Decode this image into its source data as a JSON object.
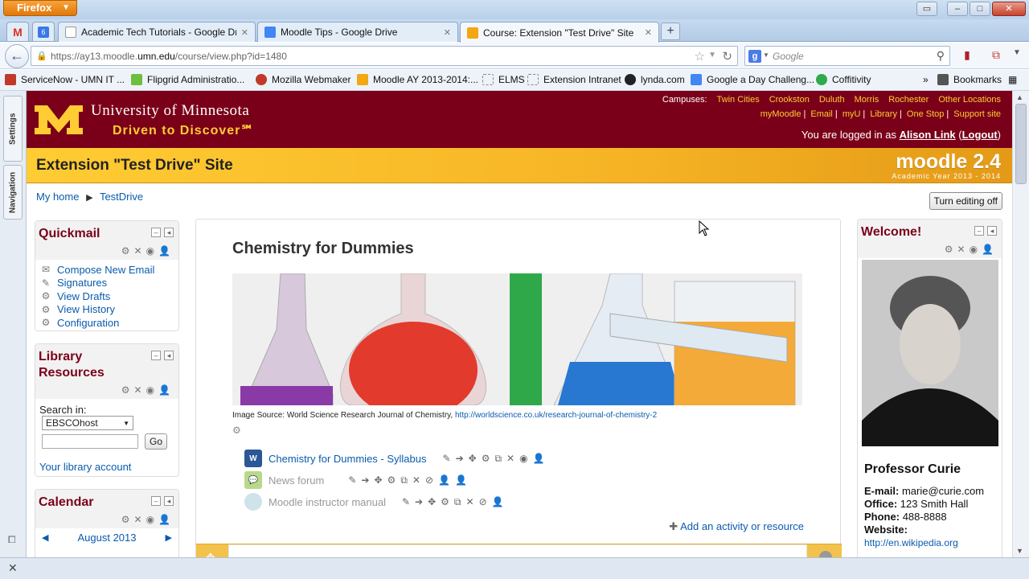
{
  "browser": {
    "menu_label": "Firefox",
    "tabs": [
      {
        "title": "Academic Tech Tutorials - Google Dri..."
      },
      {
        "title": "Moodle Tips - Google Drive"
      },
      {
        "title": "Course: Extension \"Test Drive\" Site"
      }
    ],
    "url_prefix": "https://ay13.moodle.",
    "url_host": "umn.edu",
    "url_path": "/course/view.php?id=1480",
    "search_placeholder": "Google",
    "bookmarks": [
      {
        "label": "ServiceNow - UMN IT ..."
      },
      {
        "label": "Flipgrid Administratio..."
      },
      {
        "label": "Mozilla Webmaker"
      },
      {
        "label": "Moodle AY 2013-2014:..."
      },
      {
        "label": "ELMS"
      },
      {
        "label": "Extension Intranet"
      },
      {
        "label": "lynda.com"
      },
      {
        "label": "Google a Day Challeng..."
      },
      {
        "label": "Coffitivity"
      }
    ],
    "bookmarks_menu": "Bookmarks",
    "overflow": "»"
  },
  "sidebar": {
    "settings": "Settings",
    "navigation": "Navigation"
  },
  "header": {
    "university": "University of Minnesota",
    "tagline": "Driven to Discover℠",
    "campuses_label": "Campuses:",
    "campuses": [
      "Twin Cities",
      "Crookston",
      "Duluth",
      "Morris",
      "Rochester",
      "Other Locations"
    ],
    "links": [
      "myMoodle",
      "Email",
      "myU",
      "Library",
      "One Stop",
      "Support site"
    ],
    "logged_prefix": "You are logged in as",
    "user": "Alison Link",
    "logout": "Logout"
  },
  "course_bar": {
    "site_title": "Extension \"Test Drive\" Site",
    "moodle_version": "moodle 2.4",
    "academic_year": "Academic Year 2013 - 2014"
  },
  "breadcrumb": [
    "My home",
    "TestDrive"
  ],
  "edit_button": "Turn editing off",
  "quickmail": {
    "title": "Quickmail",
    "items": [
      "Compose New Email",
      "Signatures",
      "View Drafts",
      "View History",
      "Configuration"
    ]
  },
  "library": {
    "title_line1": "Library",
    "title_line2": "Resources",
    "search_in_label": "Search in:",
    "select_value": "EBSCOhost",
    "go": "Go",
    "account_link": "Your library account"
  },
  "calendar": {
    "title": "Calendar",
    "month": "August 2013"
  },
  "main": {
    "course_title": "Chemistry for Dummies",
    "caption_prefix": "Image Source: World Science Research Journal of Chemistry,",
    "caption_link": "http://worldscience.co.uk/research-journal-of-chemistry-2",
    "activities": [
      {
        "label": "Chemistry for Dummies - Syllabus",
        "dim": false
      },
      {
        "label": "News forum",
        "dim": true
      },
      {
        "label": "Moodle instructor manual",
        "dim": true
      }
    ],
    "add_activity": "Add an activity or resource"
  },
  "welcome": {
    "title": "Welcome!",
    "name": "Professor Curie",
    "email_label": "E-mail:",
    "email": "marie@curie.com",
    "office_label": "Office:",
    "office": "123 Smith Hall",
    "phone_label": "Phone:",
    "phone": "488-8888",
    "website_label": "Website:",
    "website": "http://en.wikipedia.org"
  },
  "colors": {
    "maroon": "#7a0019",
    "gold": "#ffcc33",
    "link": "#0a5bad"
  }
}
